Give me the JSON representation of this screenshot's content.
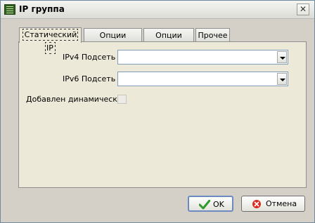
{
  "window": {
    "title": "IP группа"
  },
  "tabs": [
    {
      "label": "Статический IP",
      "active": true
    },
    {
      "label": "Опции RADIUS",
      "active": false
    },
    {
      "label": "Опции DHCP",
      "active": false
    },
    {
      "label": "Прочее",
      "active": false
    }
  ],
  "form": {
    "ipv4": {
      "label": "IPv4 Подсеть",
      "value": ""
    },
    "ipv6": {
      "label": "IPv6 Подсеть",
      "value": ""
    },
    "dynamic": {
      "label": "Добавлен динамически",
      "checked": false,
      "enabled": false
    }
  },
  "buttons": {
    "ok": "OK",
    "cancel": "Отмена"
  },
  "icons": {
    "ok": "checkmark-icon",
    "cancel": "cancel-icon",
    "close": "close-icon",
    "app": "app-icon"
  },
  "colors": {
    "ok_check": "#2e9a2a",
    "cancel_red": "#d92b1f"
  }
}
